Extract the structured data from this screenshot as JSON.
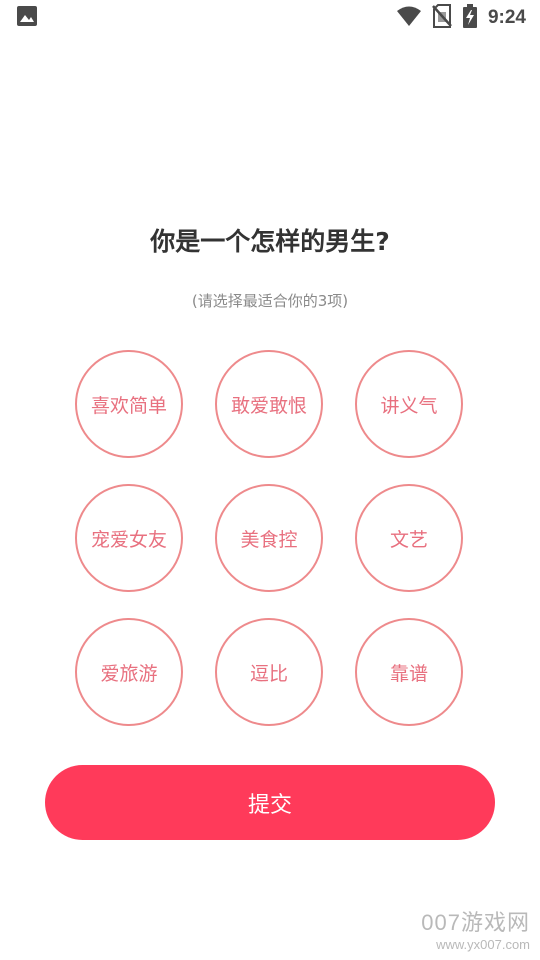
{
  "status_bar": {
    "time": "9:24"
  },
  "question": {
    "title": "你是一个怎样的男生?",
    "hint": "(请选择最适合你的3项)"
  },
  "options": [
    {
      "label": "喜欢简单"
    },
    {
      "label": "敢爱敢恨"
    },
    {
      "label": "讲义气"
    },
    {
      "label": "宠爱女友"
    },
    {
      "label": "美食控"
    },
    {
      "label": "文艺"
    },
    {
      "label": "爱旅游"
    },
    {
      "label": "逗比"
    },
    {
      "label": "靠谱"
    }
  ],
  "submit": {
    "label": "提交"
  },
  "watermark": {
    "logo": "007游戏网",
    "url": "www.yx007.com"
  },
  "colors": {
    "accent": "#ff3a5a",
    "option_border": "#ee8a8c",
    "option_text": "#e8707f"
  }
}
